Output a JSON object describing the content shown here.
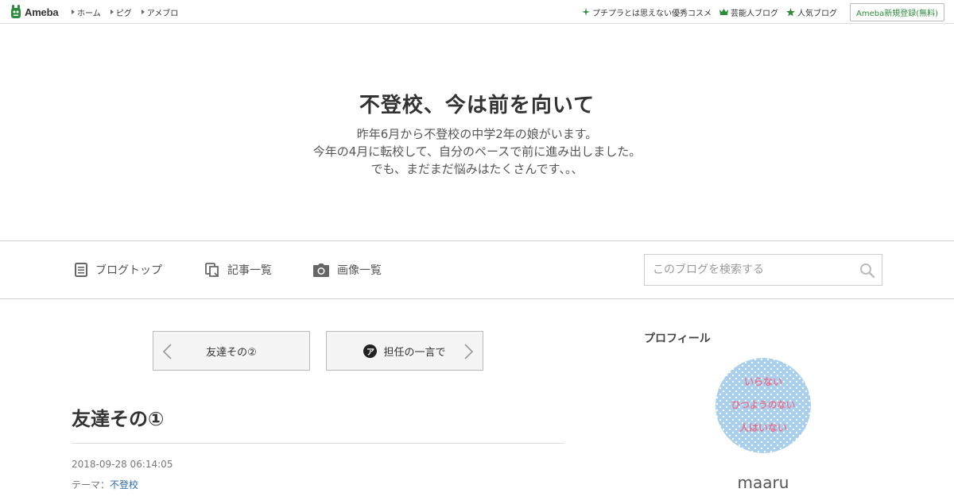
{
  "topbar": {
    "logo_text": "Ameba",
    "left_links": [
      "ホーム",
      "ピグ",
      "アメブロ"
    ],
    "right_links": [
      {
        "label": "プチプラとは思えない優秀コスメ",
        "icon": "sparkle-icon"
      },
      {
        "label": "芸能人ブログ",
        "icon": "crown-icon"
      },
      {
        "label": "人気ブログ",
        "icon": "star-icon"
      }
    ],
    "register_label": "Ameba新規登録(無料)"
  },
  "header": {
    "title": "不登校、今は前を向いて",
    "description": [
      "昨年6月から不登校の中学2年の娘がいます。",
      "今年の4月に転校して、自分のペースで前に進み出しました。",
      "でも、まだまだ悩みはたくさんです、。、"
    ]
  },
  "nav": {
    "items": [
      {
        "label": "ブログトップ",
        "icon": "blog-top-icon"
      },
      {
        "label": "記事一覧",
        "icon": "entries-icon"
      },
      {
        "label": "画像一覧",
        "icon": "camera-icon"
      }
    ],
    "search_placeholder": "このブログを検索する"
  },
  "pager": {
    "prev_label": "友達その②",
    "next_label": "担任の一言で",
    "next_badge": "ア"
  },
  "entry": {
    "title": "友達その①",
    "date": "2018-09-28 06:14:05",
    "theme_prefix": "テーマ：",
    "theme": "不登校"
  },
  "sidebar": {
    "profile_heading": "プロフィール",
    "avatar_lines": [
      "いらない",
      "ひつようのない",
      "人はいない"
    ],
    "profile_name": "maaru"
  },
  "colors": {
    "ameba_green": "#2d8c3c",
    "link_blue": "#2a6ca8",
    "avatar_bg": "#a9cfee",
    "avatar_text": "#e8708a"
  }
}
